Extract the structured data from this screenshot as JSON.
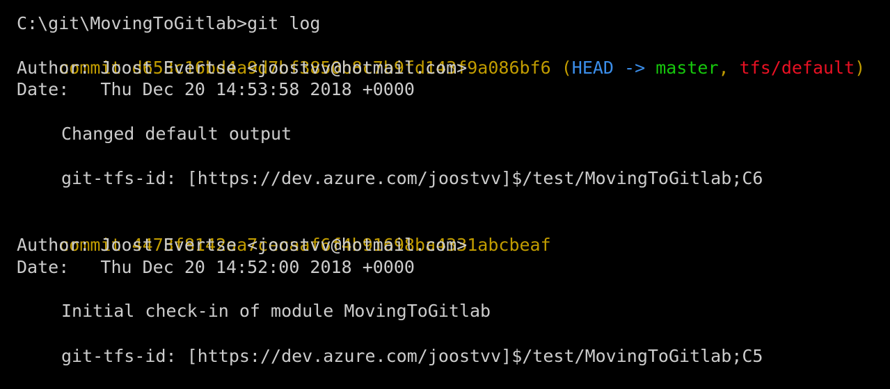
{
  "terminal": {
    "prompt_line": "C:\\git\\MovingToGitlab>git log",
    "commits": [
      {
        "commit_keyword": "commit",
        "hash": "d653c16bd4a9d7bf3850b8c7b9fd143f9a086bf6",
        "refs": {
          "open": "(",
          "head": "HEAD -> ",
          "branch": "master",
          "separator": ", ",
          "remote": "tfs/default",
          "close": ")"
        },
        "author_line": "Author: Joost Evertse <joostvv@hotmail.com>",
        "date_line": "Date:   Thu Dec 20 14:53:58 2018 +0000",
        "message": "Changed default output",
        "tfs_id": "git-tfs-id: [https://dev.azure.com/joostvv]$/test/MovingToGitlab;C6"
      },
      {
        "commit_keyword": "commit",
        "hash": "4473f8142aa7cecaaf6f4b91698ba4331abcbeaf",
        "author_line": "Author: Joost Evertse <joostvv@hotmail.com>",
        "date_line": "Date:   Thu Dec 20 14:52:00 2018 +0000",
        "message": "Initial check-in of module MovingToGitlab",
        "tfs_id": "git-tfs-id: [https://dev.azure.com/joostvv]$/test/MovingToGitlab;C5"
      }
    ],
    "colors": {
      "background": "#000000",
      "text": "#cccccc",
      "commit": "#c19c00",
      "head": "#3b8eea",
      "branch": "#16c60c",
      "remote": "#e81123"
    }
  }
}
